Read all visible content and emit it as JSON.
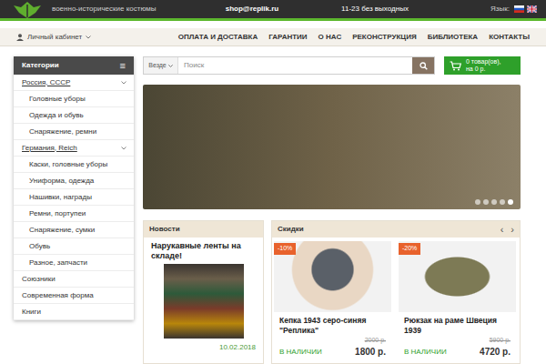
{
  "header": {
    "tagline": "военно-исторические костюмы",
    "email": "shop@replik.ru",
    "hours": "11-23 без выходных",
    "language_label": "Язык:"
  },
  "account": {
    "label": "Личный кабинет"
  },
  "nav": [
    "ОПЛАТА И ДОСТАВКА",
    "ГАРАНТИИ",
    "О НАС",
    "РЕКОНСТРУКЦИЯ",
    "БИБЛИОТЕКА",
    "КОНТАКТЫ"
  ],
  "categories": {
    "title": "Категории",
    "menu_icon": "≡",
    "items": [
      {
        "label": "Россия, СССР",
        "kind": "group"
      },
      {
        "label": "Головные уборы",
        "kind": "sub"
      },
      {
        "label": "Одежда и обувь",
        "kind": "sub"
      },
      {
        "label": "Снаряжение, ремни",
        "kind": "sub"
      },
      {
        "label": "Германия, Reich",
        "kind": "group"
      },
      {
        "label": "Каски, головные уборы",
        "kind": "sub"
      },
      {
        "label": "Униформа, одежда",
        "kind": "sub"
      },
      {
        "label": "Нашивки, награды",
        "kind": "sub"
      },
      {
        "label": "Ремни, портупеи",
        "kind": "sub"
      },
      {
        "label": "Снаряжение, сумки",
        "kind": "sub"
      },
      {
        "label": "Обувь",
        "kind": "sub"
      },
      {
        "label": "Разное, запчасти",
        "kind": "sub"
      },
      {
        "label": "Союзники",
        "kind": "top"
      },
      {
        "label": "Современная форма",
        "kind": "top"
      },
      {
        "label": "Книги",
        "kind": "top"
      }
    ]
  },
  "search": {
    "scope": "Везде",
    "placeholder": "Поиск"
  },
  "cart": {
    "count": "0 товар(ов),",
    "total": "на 0 р."
  },
  "banner": {
    "slides": [
      {
        "selected": false
      },
      {
        "selected": false
      },
      {
        "selected": false
      },
      {
        "selected": false
      },
      {
        "selected": true
      }
    ]
  },
  "news": {
    "title": "Новости",
    "items": [
      {
        "title": "Нарукавные ленты на складе!",
        "date": "10.02.2018"
      }
    ]
  },
  "discounts": {
    "title": "Скидки",
    "prev": "‹",
    "next": "›",
    "products": [
      {
        "badge": "-10%",
        "name": "Кепка 1943 серо-синяя \"Реплика\"",
        "old_price": "2000 р.",
        "availability": "В НАЛИЧИИ",
        "price": "1800 р."
      },
      {
        "badge": "-20%",
        "name": "Рюкзак на раме Швеция 1939",
        "old_price": "5900 р.",
        "availability": "В НАЛИЧИИ",
        "price": "4720 р."
      }
    ]
  }
}
